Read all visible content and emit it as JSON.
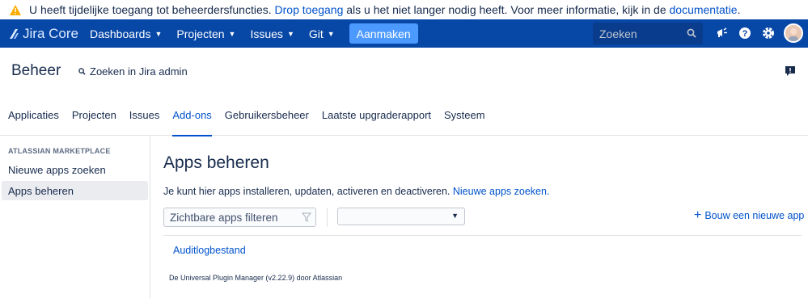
{
  "warning": {
    "text_before": "U heeft tijdelijke toegang tot beheerdersfuncties. ",
    "link1": "Drop toegang",
    "text_middle": " als u het niet langer nodig heeft. Voor meer informatie, kijk in de ",
    "link2": "documentatie",
    "text_after": "."
  },
  "topnav": {
    "logo": "Jira Core",
    "items": [
      "Dashboards",
      "Projecten",
      "Issues",
      "Git"
    ],
    "create": "Aanmaken",
    "search_placeholder": "Zoeken"
  },
  "admin": {
    "title": "Beheer",
    "search": "Zoeken in Jira admin"
  },
  "tabs": [
    "Applicaties",
    "Projecten",
    "Issues",
    "Add-ons",
    "Gebruikersbeheer",
    "Laatste upgraderapport",
    "Systeem"
  ],
  "active_tab": "Add-ons",
  "sidebar": {
    "heading": "ATLASSIAN MARKETPLACE",
    "items": [
      "Nieuwe apps zoeken",
      "Apps beheren"
    ]
  },
  "main": {
    "title": "Apps beheren",
    "intro": "Je kunt hier apps installeren, updaten, activeren en deactiveren. ",
    "intro_link": "Nieuwe apps zoeken.",
    "filter_placeholder": "Zichtbare apps filteren",
    "select_value": "",
    "build_link": "Bouw een nieuwe app",
    "audit_link": "Auditlogbestand",
    "footer": "De Universal Plugin Manager (v2.22.9) door Atlassian"
  },
  "colors": {
    "nav_bg": "#0747a6",
    "accent": "#0052cc",
    "create_btn": "#4c9aff",
    "warning_icon": "#ffab00"
  }
}
